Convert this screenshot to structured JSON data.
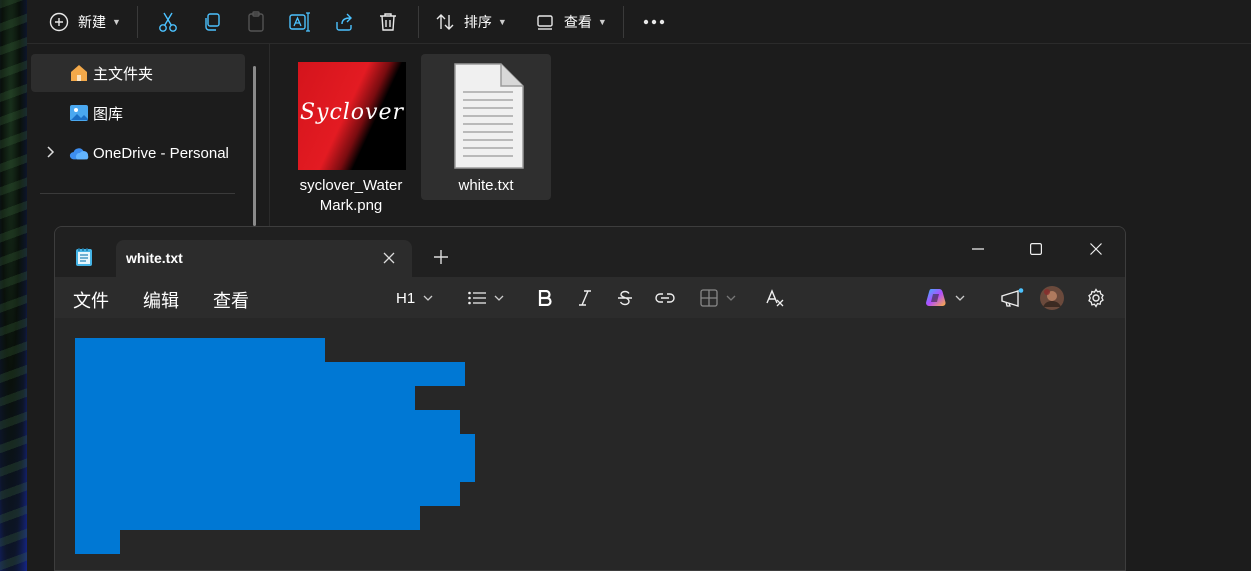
{
  "explorer": {
    "toolbar": {
      "new_label": "新建",
      "sort_label": "排序",
      "view_label": "查看"
    },
    "nav": {
      "items": [
        {
          "label": "主文件夹",
          "icon": "home-icon",
          "selected": true
        },
        {
          "label": "图库",
          "icon": "gallery-icon",
          "selected": false
        },
        {
          "label": "OneDrive - Personal",
          "icon": "cloud-icon",
          "selected": false,
          "expandable": true
        }
      ]
    },
    "files": [
      {
        "name": "syclover_WaterMark.png",
        "line1": "syclover_Water",
        "line2": "Mark.png",
        "thumb_text": "Syclover",
        "type": "image"
      },
      {
        "name": "white.txt",
        "line1": "white.txt",
        "line2": "",
        "type": "text",
        "selected": true
      }
    ]
  },
  "notepad": {
    "tab_title": "white.txt",
    "menus": {
      "file": "文件",
      "edit": "编辑",
      "view": "查看"
    },
    "heading_label": "H1"
  },
  "colors": {
    "accent": "#0078d4",
    "window_bg": "#272727",
    "titlebar_bg": "#202020",
    "explorer_bg": "#1c1c1c",
    "selection": "#2f2f2f"
  }
}
